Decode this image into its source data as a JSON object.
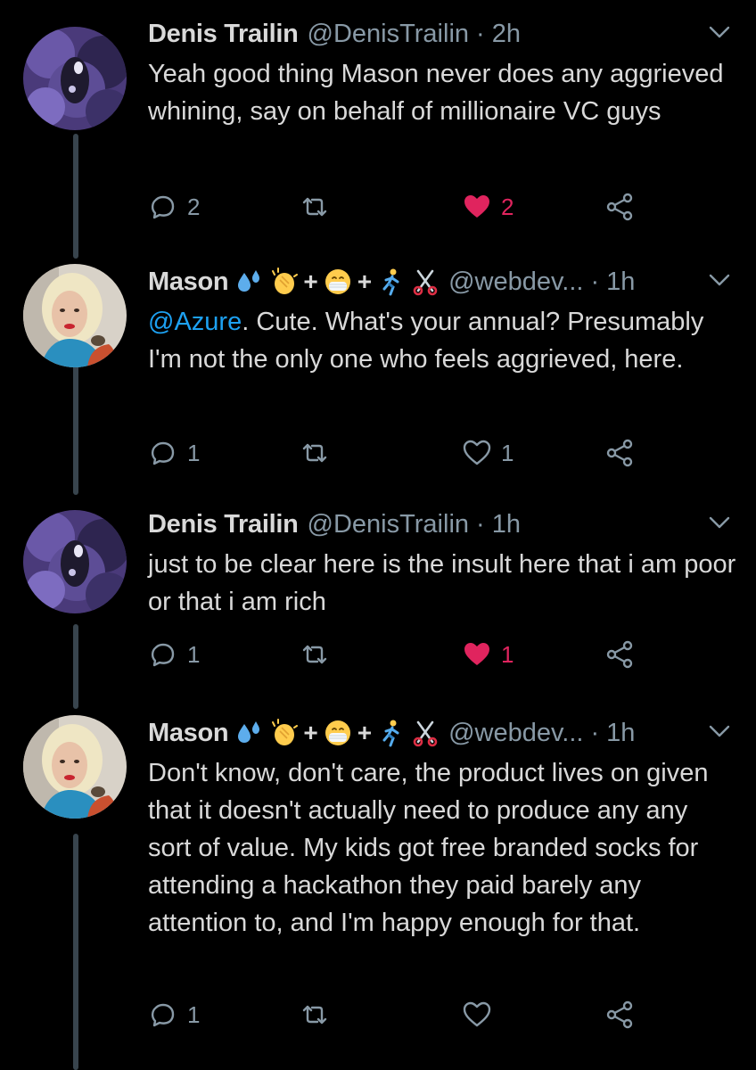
{
  "tweets": [
    {
      "name": "Denis Trailin",
      "handle": "@DenisTrailin",
      "dot": "·",
      "time": "2h",
      "text": "Yeah good thing Mason never does any aggrieved whining, say on behalf of millionaire VC guys",
      "mention": "",
      "reply_count": "2",
      "like_count": "2",
      "liked": true,
      "avatar": "purple-rock-avatar"
    },
    {
      "name": "Mason",
      "handle": "@webdev...",
      "dot": "·",
      "time": "1h",
      "mention": "@Azure",
      "text": ". Cute. What's your annual? Presumably I'm not the only one who feels aggrieved, here.",
      "reply_count": "1",
      "like_count": "1",
      "liked": false,
      "avatar": "blonde-person-avatar"
    },
    {
      "name": "Denis Trailin",
      "handle": "@DenisTrailin",
      "dot": "·",
      "time": "1h",
      "text": "just to be clear here is the insult here that i am poor or that i am rich",
      "mention": "",
      "reply_count": "1",
      "like_count": "1",
      "liked": true,
      "avatar": "purple-rock-avatar"
    },
    {
      "name": "Mason",
      "handle": "@webdev...",
      "dot": "·",
      "time": "1h",
      "mention": "",
      "text": "Don't know, don't care, the product lives on given that it doesn't actually need to produce any any sort of value. My kids got free branded socks for attending a hackathon they paid barely any attention to, and I'm happy enough for that.",
      "reply_count": "1",
      "like_count": "",
      "liked": false,
      "avatar": "blonde-person-avatar"
    }
  ],
  "name_emoji": {
    "plus": "+",
    "icons": [
      "sweat-droplets-icon",
      "clapping-hands-icon",
      "medical-mask-face-icon",
      "person-running-icon",
      "scissors-icon"
    ]
  },
  "colors": {
    "background": "#000000",
    "text": "#d9d9d9",
    "secondary": "#8899a6",
    "mention": "#1da1f2",
    "like": "#e0245e",
    "thread_line": "#38444d"
  }
}
